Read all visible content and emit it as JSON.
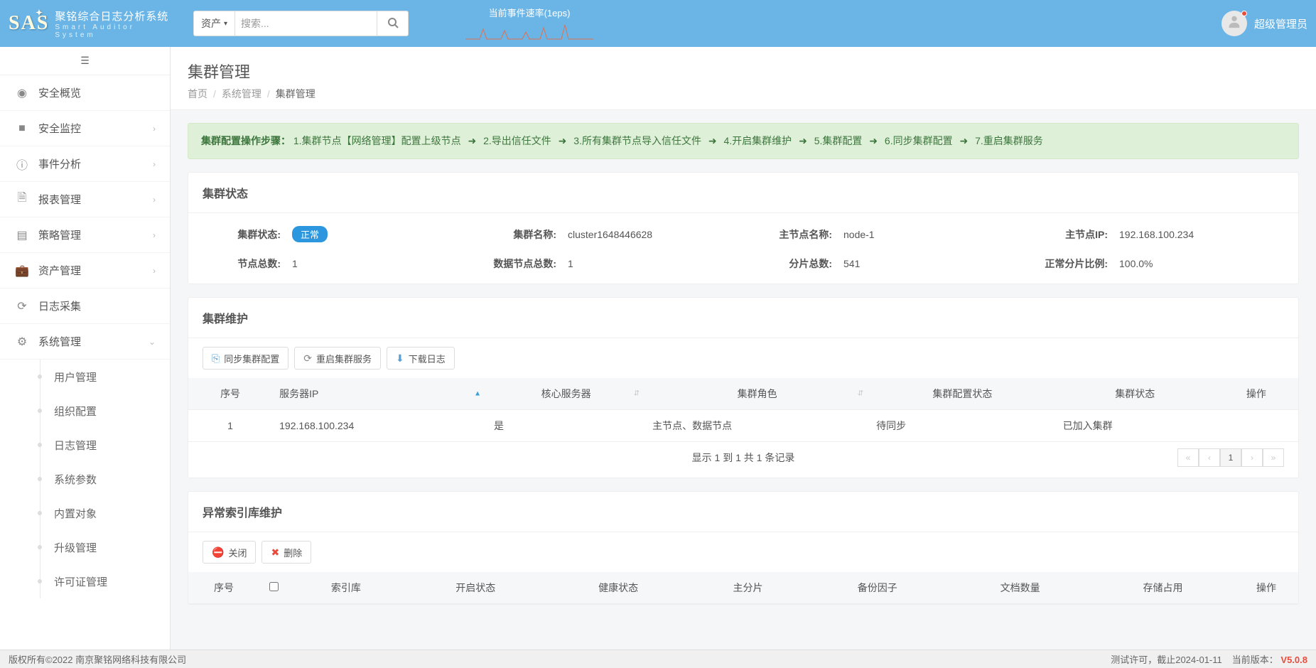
{
  "header": {
    "logo_cn": "聚铭综合日志分析系统",
    "logo_en": "Smart Auditor System",
    "asset_dropdown": "资产",
    "search_placeholder": "搜索...",
    "event_rate_label": "当前事件速率(1eps)",
    "username": "超级管理员"
  },
  "sidebar": {
    "items": [
      {
        "icon": "dashboard",
        "label": "安全概览",
        "expandable": false
      },
      {
        "icon": "video",
        "label": "安全监控",
        "expandable": true
      },
      {
        "icon": "info",
        "label": "事件分析",
        "expandable": true
      },
      {
        "icon": "file",
        "label": "报表管理",
        "expandable": true
      },
      {
        "icon": "book",
        "label": "策略管理",
        "expandable": true
      },
      {
        "icon": "briefcase",
        "label": "资产管理",
        "expandable": true
      },
      {
        "icon": "refresh",
        "label": "日志采集",
        "expandable": false
      },
      {
        "icon": "gear",
        "label": "系统管理",
        "expandable": true,
        "expanded": true
      }
    ],
    "sub_items": [
      "用户管理",
      "组织配置",
      "日志管理",
      "系统参数",
      "内置对象",
      "升级管理",
      "许可证管理"
    ]
  },
  "page": {
    "title": "集群管理",
    "breadcrumb": {
      "home": "首页",
      "section": "系统管理",
      "current": "集群管理"
    }
  },
  "alert": {
    "prefix": "集群配置操作步骤：",
    "steps": [
      "1.集群节点【网络管理】配置上级节点",
      "2.导出信任文件",
      "3.所有集群节点导入信任文件",
      "4.开启集群维护",
      "5.集群配置",
      "6.同步集群配置",
      "7.重启集群服务"
    ]
  },
  "cluster_status": {
    "panel_title": "集群状态",
    "items": [
      {
        "label": "集群状态:",
        "value": "正常",
        "badge": true
      },
      {
        "label": "集群名称:",
        "value": "cluster1648446628"
      },
      {
        "label": "主节点名称:",
        "value": "node-1"
      },
      {
        "label": "主节点IP:",
        "value": "192.168.100.234"
      },
      {
        "label": "节点总数:",
        "value": "1"
      },
      {
        "label": "数据节点总数:",
        "value": "1"
      },
      {
        "label": "分片总数:",
        "value": "541"
      },
      {
        "label": "正常分片比例:",
        "value": "100.0%"
      }
    ]
  },
  "cluster_maint": {
    "panel_title": "集群维护",
    "buttons": [
      {
        "label": "同步集群配置",
        "icon": "sync"
      },
      {
        "label": "重启集群服务",
        "icon": "restart"
      },
      {
        "label": "下载日志",
        "icon": "download"
      }
    ],
    "columns": [
      "序号",
      "服务器IP",
      "核心服务器",
      "集群角色",
      "集群配置状态",
      "集群状态",
      "操作"
    ],
    "rows": [
      {
        "seq": "1",
        "ip": "192.168.100.234",
        "core": "是",
        "role": "主节点、数据节点",
        "cfg": "待同步",
        "status": "已加入集群",
        "op": ""
      }
    ],
    "footer_info": "显示 1 到 1 共 1 条记录",
    "page_current": "1"
  },
  "index_maint": {
    "panel_title": "异常索引库维护",
    "buttons": [
      {
        "label": "关闭",
        "icon": "close"
      },
      {
        "label": "删除",
        "icon": "delete"
      }
    ],
    "columns": [
      "序号",
      "",
      "索引库",
      "开启状态",
      "健康状态",
      "主分片",
      "备份因子",
      "文档数量",
      "存储占用",
      "操作"
    ]
  },
  "footer": {
    "copyright": "版权所有©2022 南京聚铭网络科技有限公司",
    "license": "测试许可，截止2024-01-11",
    "version_label": "当前版本：",
    "version": "V5.0.8"
  }
}
